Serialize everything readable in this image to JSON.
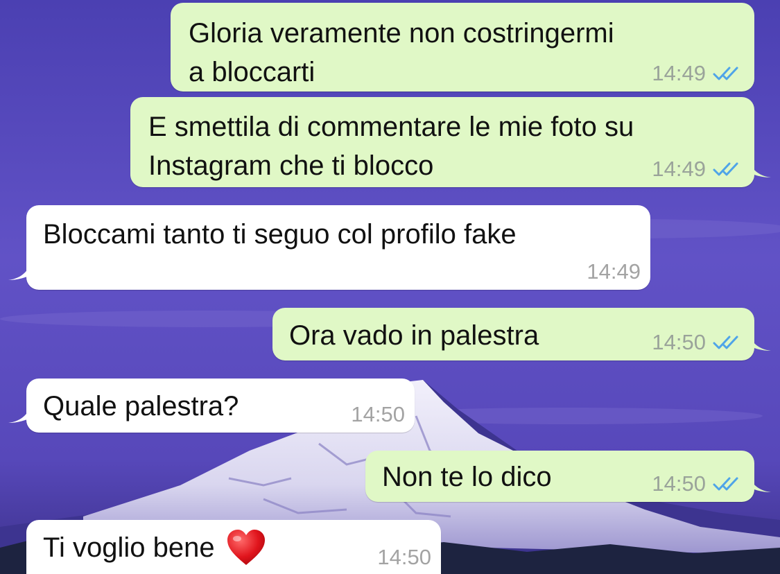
{
  "colors": {
    "outgoing_bubble": "#e0f8c6",
    "incoming_bubble": "#ffffff",
    "read_ticks": "#4fa4e8",
    "timestamp": "#9aa39a",
    "wallpaper": "#5a4cc0"
  },
  "messages": [
    {
      "direction": "outgoing",
      "text": "Gloria veramente non costringermi\na bloccarti",
      "time": "14:49",
      "ticks": "double-check-read-icon"
    },
    {
      "direction": "outgoing",
      "text": "E smettila di commentare le mie foto su\nInstagram che ti blocco",
      "time": "14:49",
      "ticks": "double-check-read-icon"
    },
    {
      "direction": "incoming",
      "text": "Bloccami tanto ti seguo col profilo fake",
      "time": "14:49"
    },
    {
      "direction": "outgoing",
      "text": "Ora vado in palestra",
      "time": "14:50",
      "ticks": "double-check-read-icon"
    },
    {
      "direction": "incoming",
      "text": "Quale palestra?",
      "time": "14:50"
    },
    {
      "direction": "outgoing",
      "text": "Non te lo dico",
      "time": "14:50",
      "ticks": "double-check-read-icon"
    },
    {
      "direction": "incoming",
      "text": "Ti voglio bene",
      "time": "14:50",
      "emoji": "red-heart-icon"
    }
  ]
}
